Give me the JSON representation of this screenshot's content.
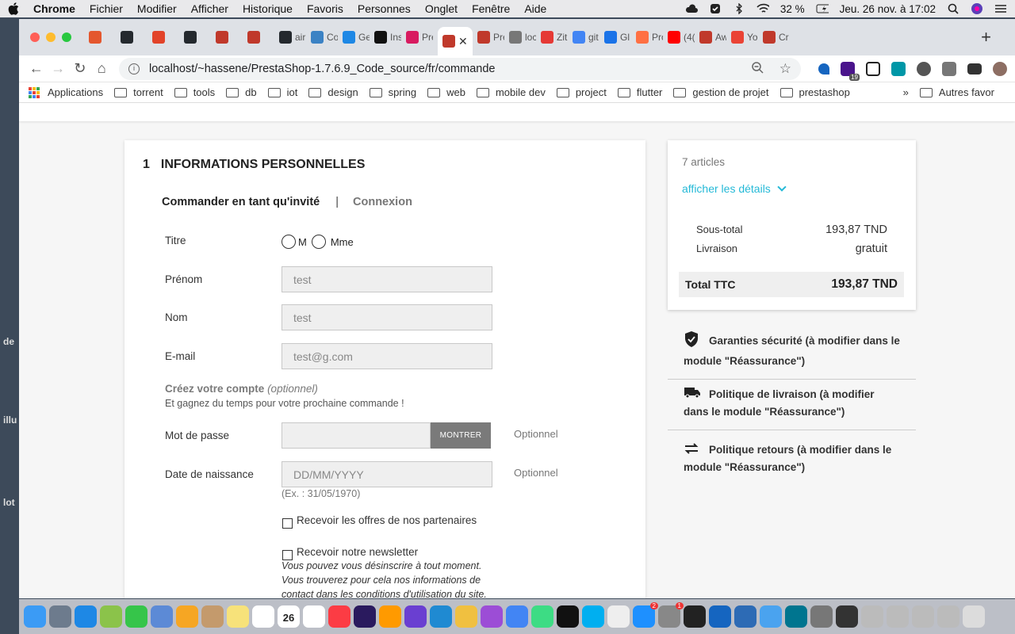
{
  "menubar": {
    "app": "Chrome",
    "items": [
      "Fichier",
      "Modifier",
      "Afficher",
      "Historique",
      "Favoris",
      "Personnes",
      "Onglet",
      "Fenêtre",
      "Aide"
    ],
    "battery": "32 %",
    "datetime": "Jeu. 26 nov. à 17:02"
  },
  "desktop": {
    "labels": [
      "de",
      "illu",
      "lot"
    ]
  },
  "browser": {
    "tabs": [
      {
        "label": "",
        "color": "#e4572e"
      },
      {
        "label": "",
        "color": "#24292e"
      },
      {
        "label": "",
        "color": "#e24329"
      },
      {
        "label": "",
        "color": "#24292e"
      },
      {
        "label": "",
        "color": "#c0392b"
      },
      {
        "label": "",
        "color": "#c0392b"
      },
      {
        "label": "air",
        "color": "#24292e"
      },
      {
        "label": "Co",
        "color": "#3b82c4"
      },
      {
        "label": "Ge",
        "color": "#1e88e5"
      },
      {
        "label": "Ins",
        "color": "#111111"
      },
      {
        "label": "Pré",
        "color": "#d81b60"
      },
      {
        "label": "",
        "color": "#c0392b"
      },
      {
        "label": "Pre",
        "color": "#c0392b"
      },
      {
        "label": "loc",
        "color": "#777777"
      },
      {
        "label": "Zit",
        "color": "#e53935"
      },
      {
        "label": "git",
        "color": "#4285f4"
      },
      {
        "label": "Gl",
        "color": "#1a73e8"
      },
      {
        "label": "Pro",
        "color": "#ff7043"
      },
      {
        "label": "(4(",
        "color": "#ff0000"
      },
      {
        "label": "Aw",
        "color": "#c0392b"
      },
      {
        "label": "Yo",
        "color": "#ea4335"
      },
      {
        "label": "Cr",
        "color": "#c0392b"
      }
    ],
    "active_tab_close": "✕",
    "new_tab": "+",
    "url": "localhost/~hassene/PrestaShop-1.7.6.9_Code_source/fr/commande",
    "bookmarks": [
      "Applications",
      "torrent",
      "tools",
      "db",
      "iot",
      "design",
      "spring",
      "web",
      "mobile dev",
      "project",
      "flutter",
      "gestion de projet",
      "prestashop"
    ],
    "bookmarks_more": "»",
    "bookmarks_other": "Autres favor",
    "ext_badge": "19"
  },
  "checkout": {
    "step_number": "1",
    "step_title": "Informations personnelles",
    "guest_label": "Commander en tant qu'invité",
    "separator": "|",
    "login_label": "Connexion",
    "title_label": "Titre",
    "title_options": [
      "M",
      "Mme"
    ],
    "firstname_label": "Prénom",
    "firstname_value": "test",
    "lastname_label": "Nom",
    "lastname_value": "test",
    "email_label": "E-mail",
    "email_value": "test@g.com",
    "create_account_bold": "Créez votre compte",
    "create_account_italic": "(optionnel)",
    "create_account_sub": "Et gagnez du temps pour votre prochaine commande !",
    "password_label": "Mot de passe",
    "show_button": "MONTRER",
    "optional": "Optionnel",
    "birthday_label": "Date de naissance",
    "birthday_placeholder": "DD/MM/YYYY",
    "birthday_hint": "(Ex. : 31/05/1970)",
    "partners_label": "Recevoir les offres de nos partenaires",
    "newsletter_label": "Recevoir notre newsletter",
    "newsletter_note": "Vous pouvez vous désinscrire à tout moment. Vous trouverez pour cela nos informations de contact dans les conditions d'utilisation du site."
  },
  "cart": {
    "count": "7 articles",
    "details_link": "afficher les détails",
    "subtotal_label": "Sous-total",
    "subtotal_value": "193,87 TND",
    "shipping_label": "Livraison",
    "shipping_value": "gratuit",
    "total_label": "Total TTC",
    "total_value": "193,87 TND"
  },
  "reassurance": [
    {
      "icon": "shield-icon",
      "text": "Garanties sécurité (à modifier dans le module \"Réassurance\")"
    },
    {
      "icon": "truck-icon",
      "text": "Politique de livraison (à modifier dans le module \"Réassurance\")"
    },
    {
      "icon": "exchange-icon",
      "text": "Politique retours (à modifier dans le module \"Réassurance\")"
    }
  ],
  "dock": {
    "calendar_day": "26",
    "badges": {
      "appstore": "2",
      "settings": "1"
    }
  }
}
